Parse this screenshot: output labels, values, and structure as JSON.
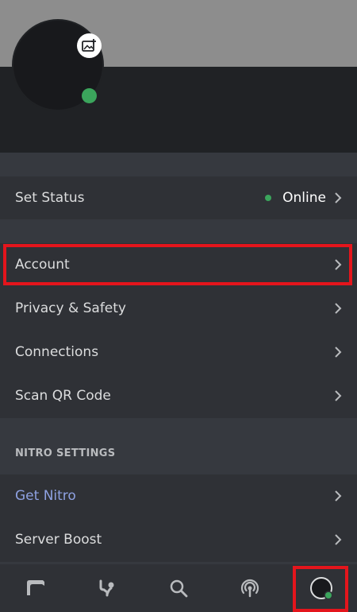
{
  "profile": {
    "avatar_icon": "avatar-icon",
    "edit_icon": "image-add-icon",
    "status_color": "#3ba55c"
  },
  "status_row": {
    "label": "Set Status",
    "value": "Online",
    "status_color": "#3ba55c"
  },
  "user_settings": {
    "items": [
      {
        "label": "Account"
      },
      {
        "label": "Privacy & Safety"
      },
      {
        "label": "Connections"
      },
      {
        "label": "Scan QR Code"
      }
    ]
  },
  "nitro_settings": {
    "title": "NITRO SETTINGS",
    "items": [
      {
        "label": "Get Nitro",
        "color": "#8ea1e1"
      },
      {
        "label": "Server Boost"
      }
    ]
  },
  "tabbar": {
    "tabs": [
      {
        "icon": "servers-icon"
      },
      {
        "icon": "friends-icon"
      },
      {
        "icon": "search-icon"
      },
      {
        "icon": "mentions-icon"
      },
      {
        "icon": "profile-icon",
        "active": true
      }
    ]
  },
  "colors": {
    "background": "#36393f",
    "section": "#2f3136",
    "highlight": "#e4151c",
    "online": "#3ba55c"
  }
}
